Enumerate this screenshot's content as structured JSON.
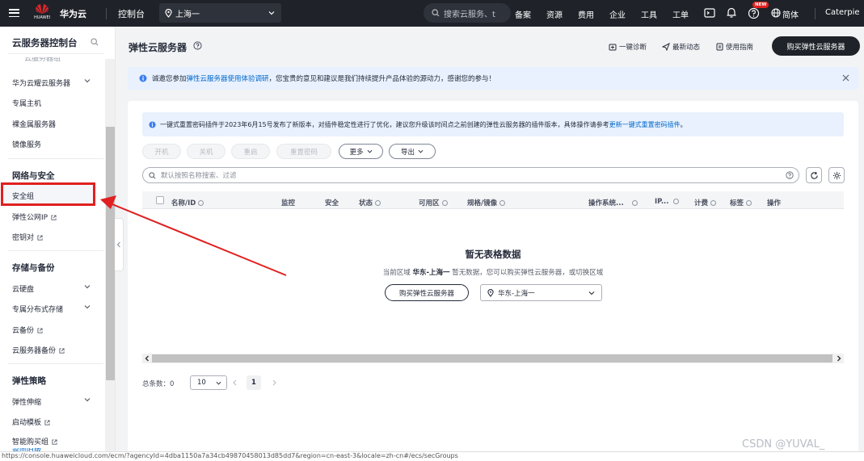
{
  "topbar": {
    "brand": "华为云",
    "huawei_label": "HUAWEI",
    "console": "控制台",
    "region": "上海一",
    "search_placeholder": "搜索云服务、t",
    "nav": [
      "备案",
      "资源",
      "费用",
      "企业",
      "工具",
      "工单"
    ],
    "new_badge": "NEW",
    "lang": "简体",
    "user": "Caterpie"
  },
  "sidebar": {
    "title": "云服务器控制台",
    "cut_item": "云服务器组",
    "items_group1": [
      {
        "label": "华为云耀云服务器",
        "chev": true
      },
      {
        "label": "专属主机"
      },
      {
        "label": "裸金属服务器"
      },
      {
        "label": "镜像服务"
      }
    ],
    "section_network": "网络与安全",
    "security_group": "安全组",
    "eip": "弹性公网IP",
    "keypair": "密钥对",
    "section_storage": "存储与备份",
    "storage_items": [
      {
        "label": "云硬盘",
        "chev": true
      },
      {
        "label": "专属分布式存储",
        "chev": true
      },
      {
        "label": "云备份",
        "ext": true
      },
      {
        "label": "云服务器备份",
        "ext": true
      }
    ],
    "section_policy": "弹性策略",
    "policy_items": [
      {
        "label": "弹性伸缩",
        "chev": true
      },
      {
        "label": "启动模板",
        "ext": true
      },
      {
        "label": "智能购买组",
        "ext": true
      }
    ],
    "cut_bottom": "返回旧版"
  },
  "header": {
    "title": "弹性云服务器",
    "actions": [
      "一键诊断",
      "最新动态",
      "使用指南"
    ],
    "buy": "购买弹性云服务器"
  },
  "survey": {
    "prefix": "诚邀您参加",
    "link": "弹性云服务器使用体验调研",
    "suffix": "，您宝贵的意见和建议是我们持续提升产品体验的源动力，感谢您的参与！"
  },
  "notice": {
    "text": "一键式重置密码插件于2023年6月15号发布了新版本，对插件稳定性进行了优化，建议您升级该时间点之前创建的弹性云服务器的插件版本，具体操作请参考",
    "link": "更新一键式重置密码插件",
    "end": "。"
  },
  "toolbar": {
    "disabled": [
      "开机",
      "关机",
      "重启",
      "重置密码"
    ],
    "more": "更多",
    "export": "导出"
  },
  "search": {
    "placeholder": "默认按照名称搜索、过滤"
  },
  "table": {
    "columns": [
      "名称/ID",
      "监控",
      "安全",
      "状态",
      "可用区",
      "规格/镜像",
      "操作系统...",
      "IP...",
      "计费",
      "标签",
      "操作"
    ]
  },
  "empty": {
    "title": "暂无表格数据",
    "desc_prefix": "当前区域 ",
    "region_bold": "华东-上海一",
    "desc_suffix": " 暂无数据，您可以购买弹性云服务器，或切换区域",
    "buy": "购买弹性云服务器",
    "region_select": "华东-上海一"
  },
  "pagination": {
    "total_label": "总条数：",
    "total": "0",
    "page_size": "10",
    "page": "1"
  },
  "status_url": "https://console.huaweicloud.com/ecm/?agencyId=4dba1150a7a34cb49870458013d85dd7&region=cn-east-3&locale=zh-cn#/ecs/secGroups",
  "watermark": "CSDN @YUVAL_",
  "colors": {
    "accent": "#0066cc",
    "highlight": "#e02020",
    "topbar": "#1f2329",
    "notice_bg": "#e8f1fd"
  }
}
